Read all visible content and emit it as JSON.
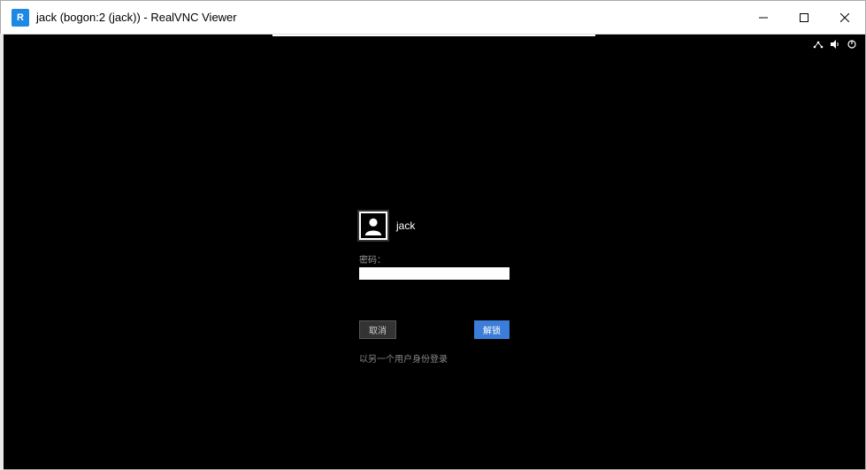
{
  "window": {
    "title": "jack (bogon:2 (jack)) - RealVNC Viewer",
    "app_icon_text": "R"
  },
  "login": {
    "username": "jack",
    "password_label": "密码：",
    "password_value": "",
    "cancel_label": "取消",
    "unlock_label": "解锁",
    "other_user_label": "以另一个用户身份登录"
  },
  "tray": {
    "network": "⋔",
    "sound": "🔊",
    "power": "⏻"
  }
}
